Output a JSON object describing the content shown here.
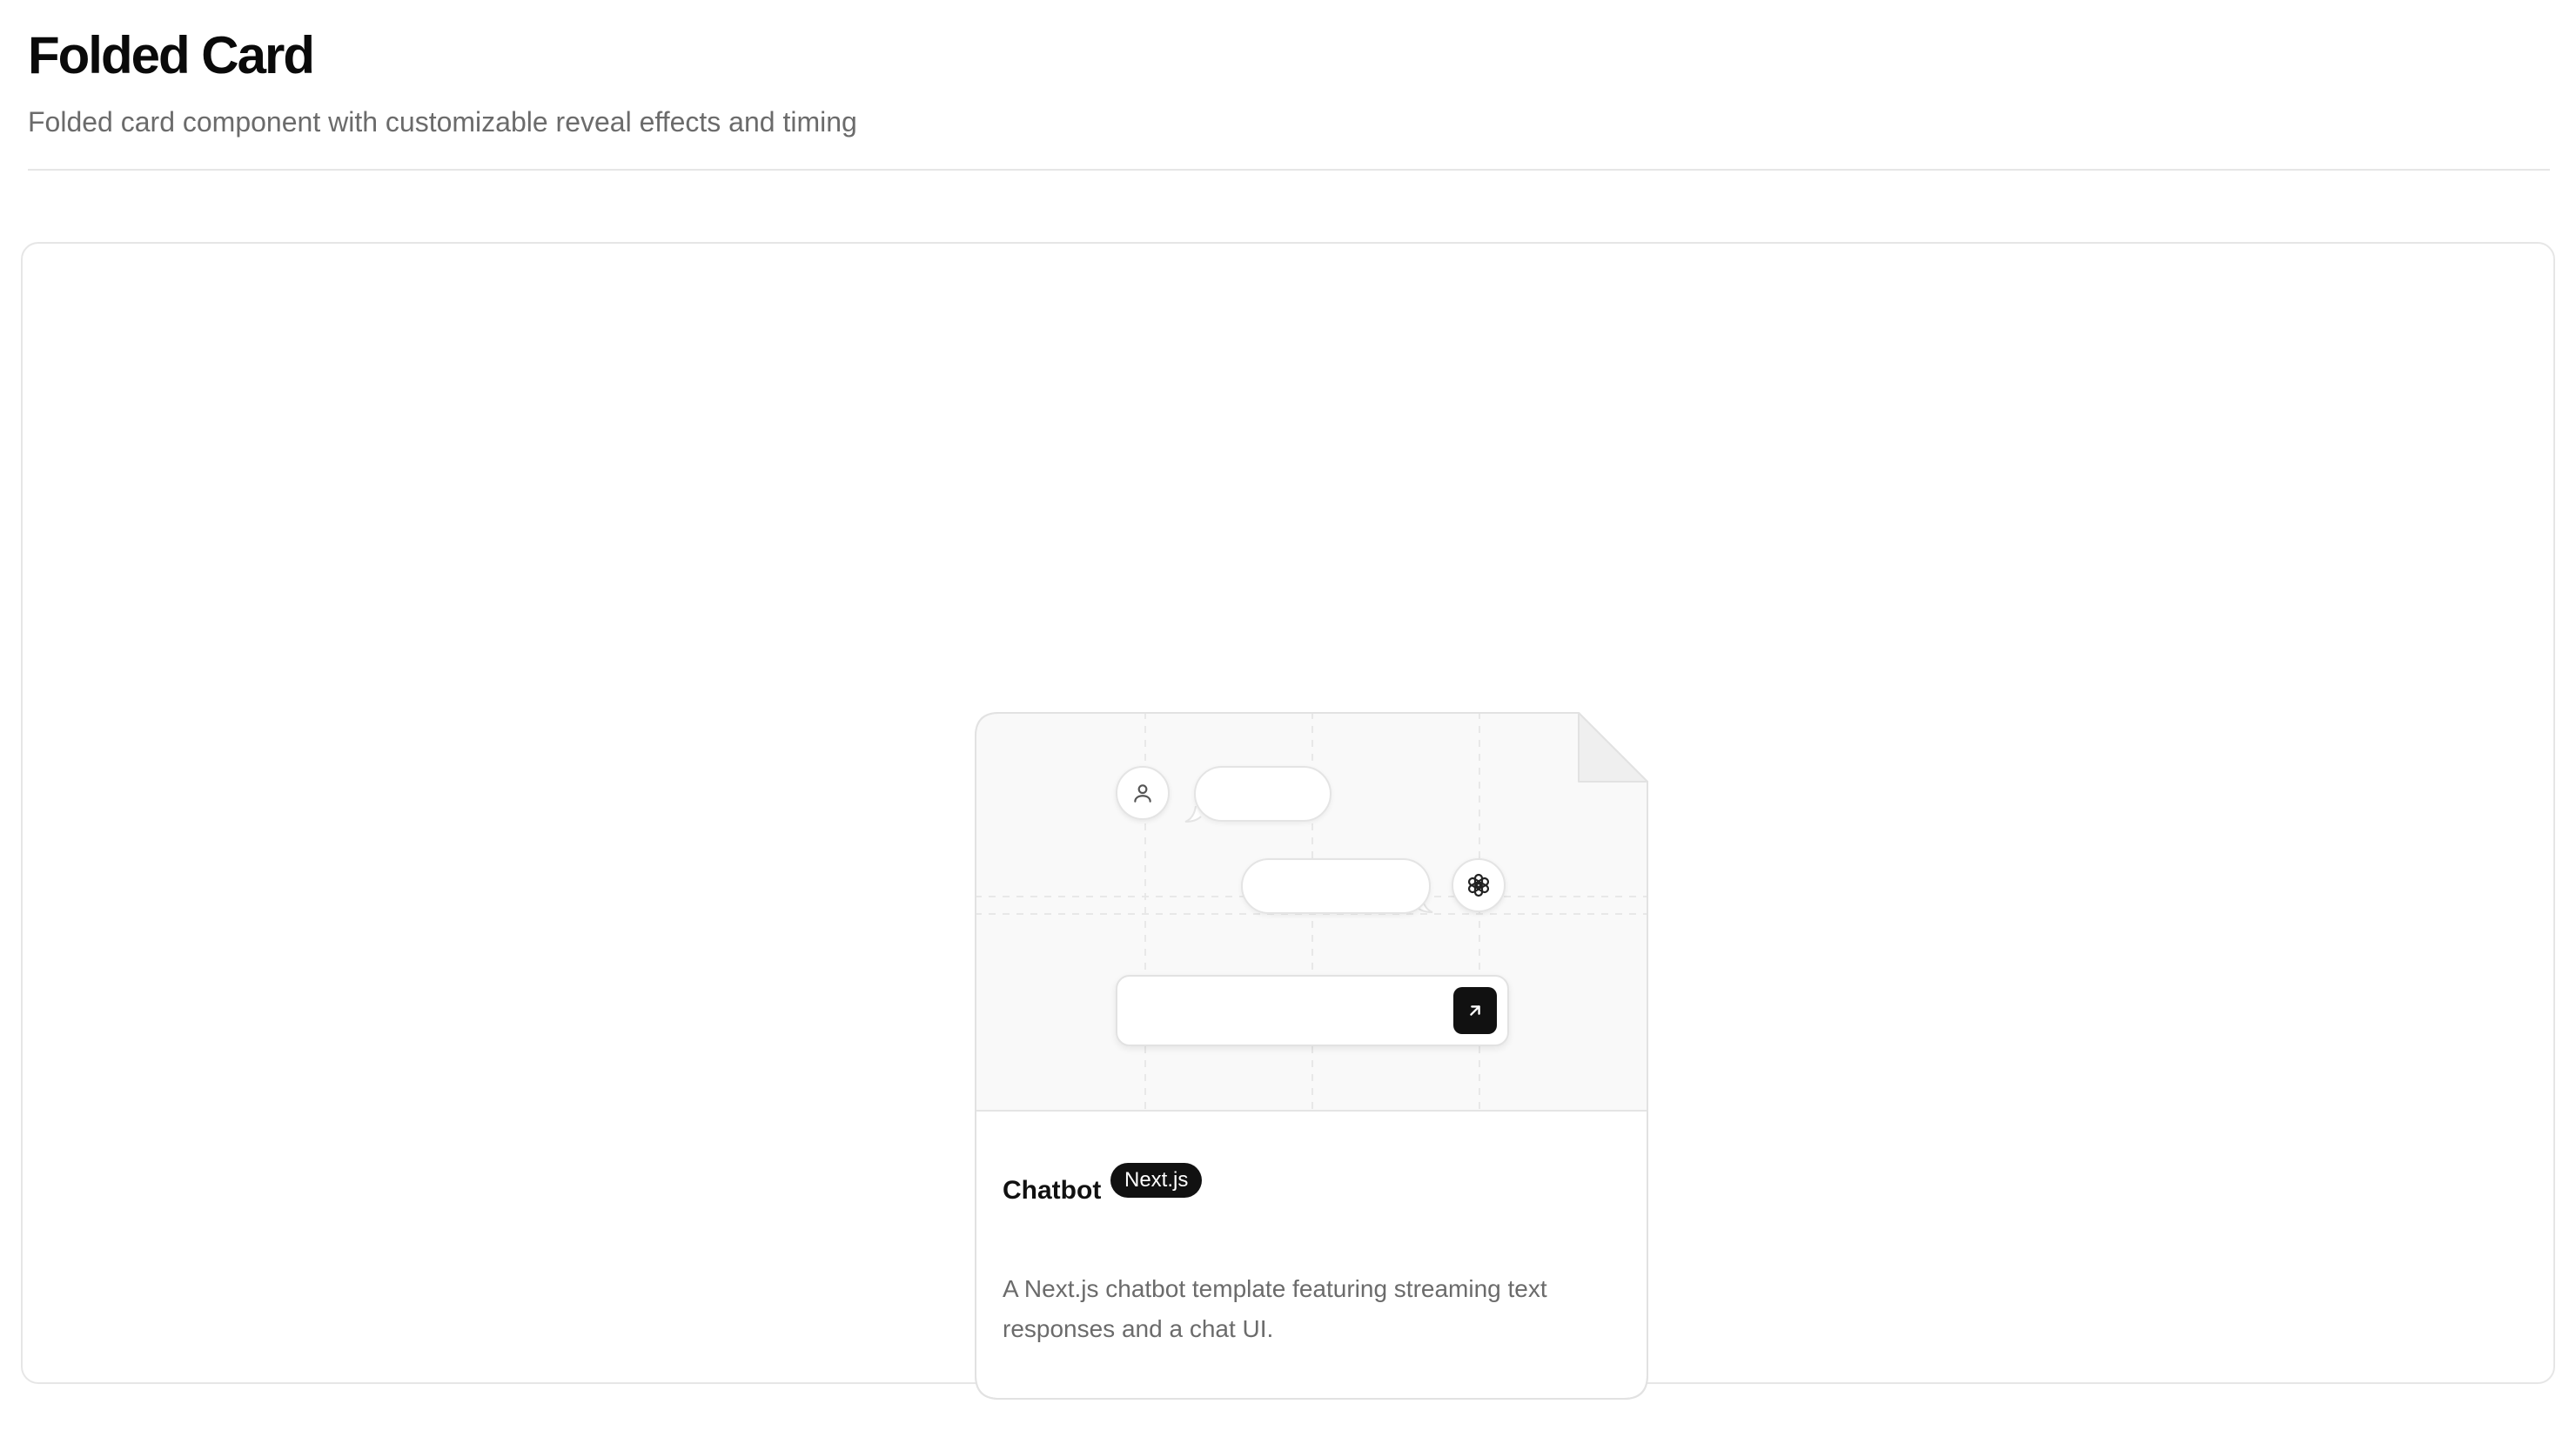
{
  "page": {
    "title": "Folded Card",
    "subtitle": "Folded card component with customizable reveal effects and timing"
  },
  "card": {
    "title": "Chatbot",
    "badge": "Next.js",
    "description": "A Next.js chatbot template featuring streaming text responses and a chat UI.",
    "illustration": {
      "user_avatar_icon": "user-icon",
      "assistant_avatar_icon": "openai-logo-icon",
      "send_button_icon": "arrow-up-right-icon"
    }
  },
  "colors": {
    "background": "#ffffff",
    "border": "#e6e6e6",
    "illustration_background": "#f9f9f9",
    "badge_background": "#111111",
    "badge_text": "#ffffff",
    "muted_text": "#6b6b6b"
  }
}
